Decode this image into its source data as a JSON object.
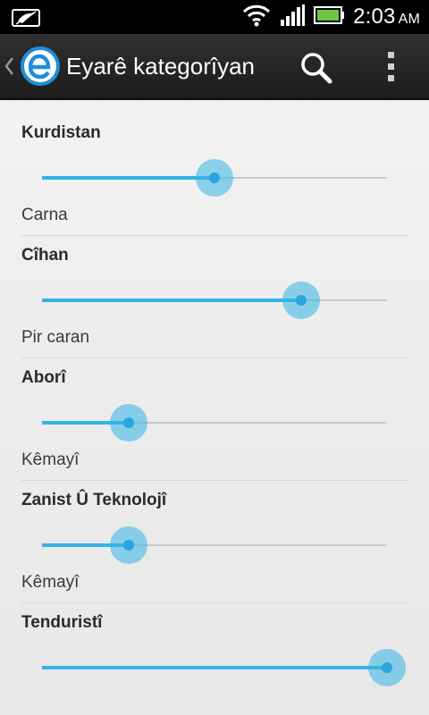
{
  "status_bar": {
    "time": "2:03",
    "ampm": "AM",
    "icons": [
      "notification-icon",
      "wifi-icon",
      "signal-icon",
      "battery-icon"
    ]
  },
  "action_bar": {
    "title": "Eyarê kategorîyan",
    "icons": [
      "back-chevron-icon",
      "app-logo-icon",
      "search-icon",
      "overflow-menu-icon"
    ]
  },
  "colors": {
    "accent": "#33b5e5",
    "action_bar": "#262626",
    "background": "#ececec"
  },
  "categories": [
    {
      "title": "Kurdistan",
      "level_label": "Carna",
      "level": 0.5
    },
    {
      "title": "Cîhan",
      "level_label": "Pir caran",
      "level": 0.75
    },
    {
      "title": "Aborî",
      "level_label": "Kêmayî",
      "level": 0.25
    },
    {
      "title": "Zanist Û Teknolojî",
      "level_label": "Kêmayî",
      "level": 0.25
    },
    {
      "title": "Tenduristî",
      "level_label": "",
      "level": 1.0
    }
  ]
}
